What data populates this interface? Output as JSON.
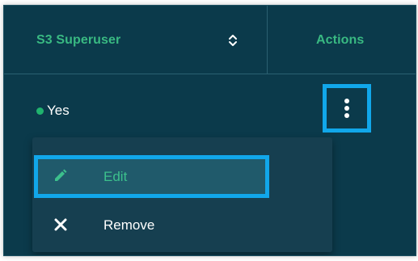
{
  "header": {
    "col_superuser": "S3 Superuser",
    "col_actions": "Actions",
    "sort_icon": "sort-up-down-icon"
  },
  "row": {
    "status_text": "Yes",
    "status_color": "#20b36e",
    "kebab_icon": "kebab-vertical-icon"
  },
  "menu": {
    "items": [
      {
        "label": "Edit",
        "icon": "pencil-icon",
        "highlighted": true
      },
      {
        "label": "Remove",
        "icon": "close-icon",
        "highlighted": false
      }
    ]
  },
  "colors": {
    "panel_bg": "#0b3a4b",
    "menu_bg": "#163f50",
    "accent_green": "#39b982",
    "highlight_blue": "#11a7ea"
  }
}
